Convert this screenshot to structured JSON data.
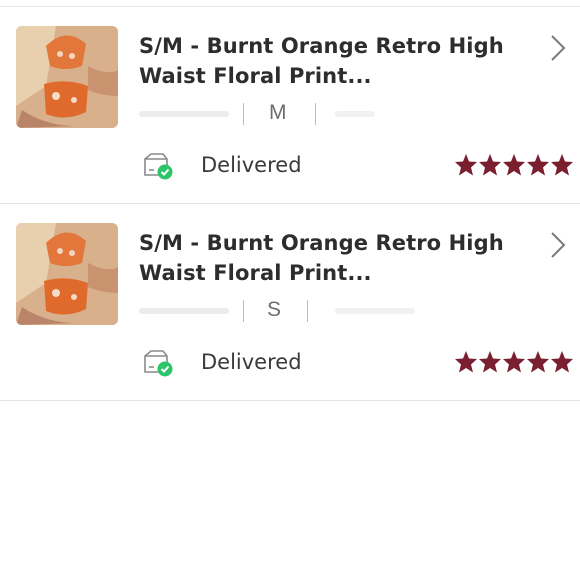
{
  "colors": {
    "star": "#7a1f2f",
    "check_badge": "#2ec46a",
    "text": "#2d2d2d",
    "divider": "#e3e3e3"
  },
  "orders": [
    {
      "title": "S/M - Burnt Orange Retro High Waist Floral Print...",
      "size": "M",
      "status": "Delivered",
      "rating": 5,
      "rating_max": 5
    },
    {
      "title": "S/M - Burnt Orange Retro High Waist Floral Print...",
      "size": "S",
      "status": "Delivered",
      "rating": 5,
      "rating_max": 5
    }
  ],
  "icons": {
    "chevron": "chevron-right-icon",
    "delivered": "package-delivered-icon",
    "star": "star-icon"
  }
}
